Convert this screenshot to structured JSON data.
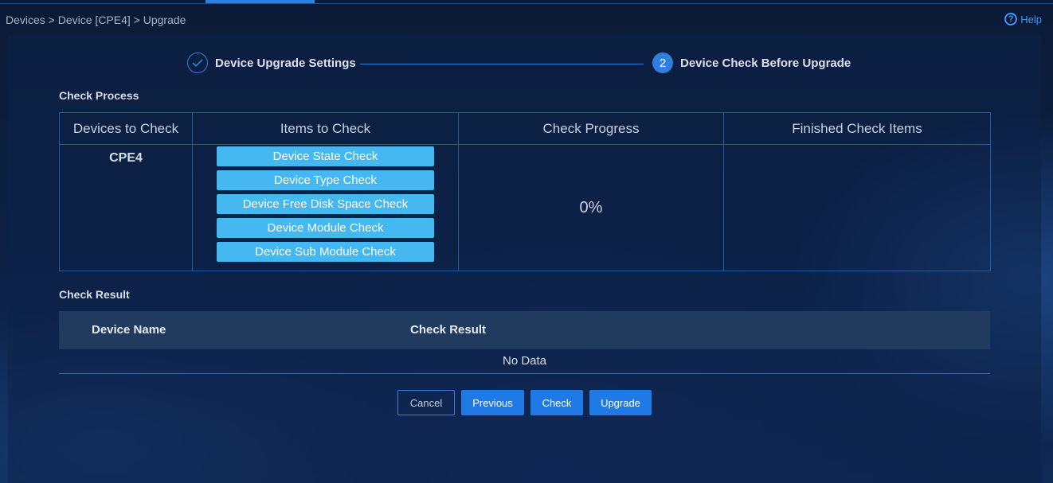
{
  "breadcrumb": "Devices > Device [CPE4] > Upgrade",
  "help": {
    "label": "Help",
    "icon": "question-icon"
  },
  "stepper": {
    "steps": [
      {
        "label": "Device Upgrade Settings",
        "status": "done",
        "icon": "checkmark-icon"
      },
      {
        "number": "2",
        "label": "Device Check Before Upgrade",
        "status": "active"
      }
    ]
  },
  "check_process": {
    "title": "Check Process",
    "headers": [
      "Devices to Check",
      "Items to Check",
      "Check Progress",
      "Finished Check Items"
    ],
    "device": "CPE4",
    "items": [
      "Device State Check",
      "Device Type Check",
      "Device Free Disk Space Check",
      "Device Module Check",
      "Device Sub Module Check"
    ],
    "progress": "0%",
    "finished_items": ""
  },
  "check_result": {
    "title": "Check Result",
    "headers": [
      "Device Name",
      "Check Result"
    ],
    "empty_text": "No Data"
  },
  "buttons": {
    "cancel": "Cancel",
    "previous": "Previous",
    "check": "Check",
    "upgrade": "Upgrade"
  },
  "colors": {
    "accent": "#1f7ae6",
    "check_item_bg": "#45b8f2",
    "background": "#0d2145"
  }
}
